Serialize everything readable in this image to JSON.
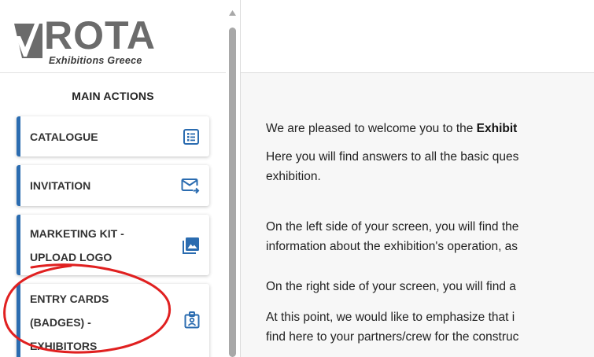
{
  "logo": {
    "name": "ROTA",
    "tagline": "Exhibitions Greece"
  },
  "sidebar": {
    "section_title": "MAIN ACTIONS",
    "items": [
      {
        "label": "CATALOGUE",
        "icon": "catalogue-list-icon"
      },
      {
        "label": "INVITATION",
        "icon": "mail-send-icon"
      },
      {
        "label_lines": [
          "MARKETING KIT -",
          "UPLOAD LOGO"
        ],
        "icon": "image-gallery-icon"
      },
      {
        "label_lines": [
          "ENTRY CARDS",
          "(BADGES) -",
          "EXHIBITORS"
        ],
        "icon": "badge-id-icon"
      }
    ]
  },
  "colors": {
    "accent": "#2b6cb0",
    "annotation": "#e02020",
    "content_bg": "#f7f7f7"
  },
  "content": {
    "p1_before": "We are pleased to welcome you to the ",
    "p1_bold": "Exhibit",
    "p2_line1": "Here you will find answers to all the basic ques",
    "p2_line2": "exhibition.",
    "p3_line1": "On the left side of your screen, you will find the",
    "p3_line2": "information about the exhibition's operation, as",
    "p4": "On the right side of your screen, you will find a",
    "p5_line1": "At this point, we would like to emphasize that i",
    "p5_line2": "find here to your partners/crew for the construc"
  }
}
